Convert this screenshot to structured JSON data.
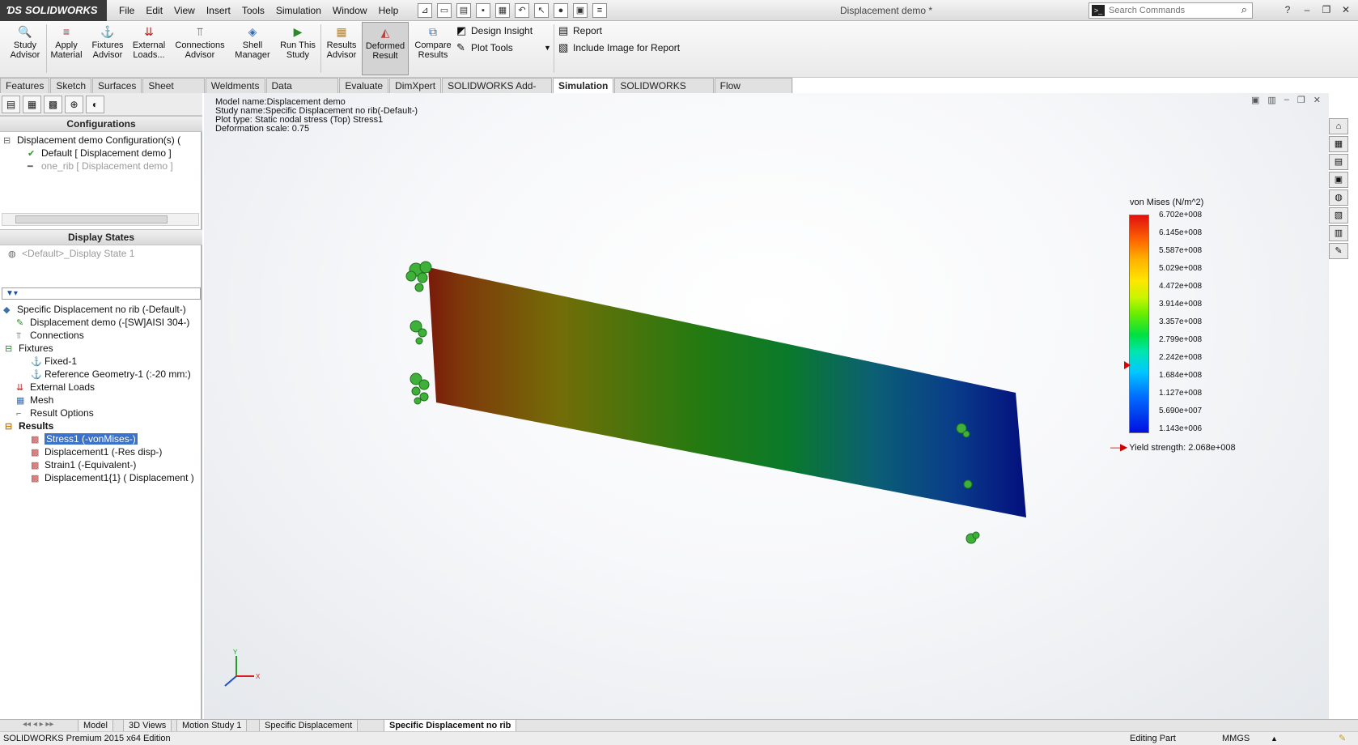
{
  "app": {
    "brand": "SOLIDWORKS",
    "menu": [
      "File",
      "Edit",
      "View",
      "Insert",
      "Tools",
      "Simulation",
      "Window",
      "Help"
    ],
    "document_title": "Displacement demo *",
    "search_placeholder": "Search Commands"
  },
  "ribbon": {
    "buttons": [
      {
        "label": "Study Advisor",
        "icon": "study-advisor-icon"
      },
      {
        "label": "Apply Material",
        "icon": "apply-material-icon"
      },
      {
        "label": "Fixtures Advisor",
        "icon": "fixtures-advisor-icon"
      },
      {
        "label": "External Loads...",
        "icon": "external-loads-icon"
      },
      {
        "label": "Connections Advisor",
        "icon": "connections-advisor-icon"
      },
      {
        "label": "Shell Manager",
        "icon": "shell-manager-icon"
      },
      {
        "label": "Run This Study",
        "icon": "run-study-icon"
      },
      {
        "label": "Results Advisor",
        "icon": "results-advisor-icon"
      },
      {
        "label": "Deformed Result",
        "icon": "deformed-result-icon"
      },
      {
        "label": "Compare Results",
        "icon": "compare-results-icon"
      }
    ],
    "small": [
      "Design Insight",
      "Plot Tools",
      "Report",
      "Include Image for Report"
    ]
  },
  "tabs": [
    "Features",
    "Sketch",
    "Surfaces",
    "Sheet Metal",
    "Weldments",
    "Data Migration",
    "Evaluate",
    "DimXpert",
    "SOLIDWORKS Add-Ins",
    "Simulation",
    "SOLIDWORKS MBD",
    "Flow Simulation"
  ],
  "active_tab": "Simulation",
  "configurations": {
    "header": "Configurations",
    "root": "Displacement demo Configuration(s)  (",
    "items": [
      "Default [ Displacement demo ]",
      "one_rib [ Displacement demo ]"
    ]
  },
  "display_states": {
    "header": "Display States",
    "item": "<Default>_Display State 1"
  },
  "study_tree": {
    "root": "Specific Displacement no rib (-Default-)",
    "items": [
      "Displacement demo (-[SW]AISI 304-)",
      "Connections",
      "Fixtures",
      "Fixed-1",
      "Reference Geometry-1 (:-20 mm:)",
      "External Loads",
      "Mesh",
      "Result Options",
      "Results",
      "Stress1 (-vonMises-)",
      "Displacement1 (-Res disp-)",
      "Strain1 (-Equivalent-)",
      "Displacement1{1} ( Displacement )"
    ]
  },
  "plot_info": {
    "model_name": "Model name:Displacement demo",
    "study_name": "Study name:Specific Displacement no rib(-Default-)",
    "plot_type": "Plot type: Static nodal stress (Top) Stress1",
    "deformation": "Deformation scale: 0.75"
  },
  "legend": {
    "title": "von Mises (N/m^2)",
    "values": [
      "6.702e+008",
      "6.145e+008",
      "5.587e+008",
      "5.029e+008",
      "4.472e+008",
      "3.914e+008",
      "3.357e+008",
      "2.799e+008",
      "2.242e+008",
      "1.684e+008",
      "1.127e+008",
      "5.690e+007",
      "1.143e+006"
    ],
    "yield": "Yield strength: 2.068e+008"
  },
  "bottom_tabs": [
    "Model",
    "3D Views",
    "Motion Study 1",
    "Specific Displacement",
    "Specific Displacement no rib"
  ],
  "active_bottom_tab": "Specific Displacement no rib",
  "status": {
    "edition": "SOLIDWORKS Premium 2015 x64 Edition",
    "mode": "Editing Part",
    "units": "MMGS"
  },
  "colors": {
    "selection": "#3a73c9",
    "stress_high": "#e01010",
    "stress_low": "#0010e0"
  }
}
